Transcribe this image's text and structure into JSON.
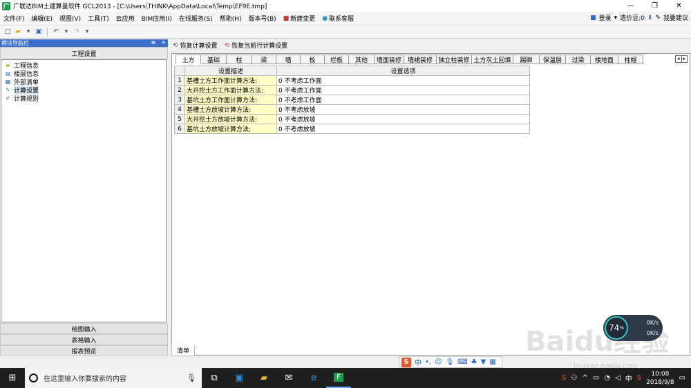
{
  "window": {
    "app_icon": "广",
    "title": "广联达BIM土建算量软件 GCL2013 - [C:\\Users\\THINK\\AppData\\Local\\Temp\\EF9E.tmp]",
    "minimize": "—",
    "restore": "❐",
    "close": "✕"
  },
  "menu": {
    "items": [
      "文件(F)",
      "编辑(E)",
      "视图(V)",
      "工具(T)",
      "云应用",
      "BIM应用(I)",
      "在线服务(S)",
      "帮助(H)",
      "版本号(B)",
      "新建变更",
      "联系客服"
    ],
    "login": "登录",
    "price_beans": "造价豆:0",
    "suggest": "我要建议"
  },
  "nav": {
    "header": "模块导航栏",
    "pin": "⊕",
    "close": "✕",
    "section_title": "工程设置",
    "tree": [
      {
        "label": "工程信息",
        "icon": "folder-icon"
      },
      {
        "label": "楼层信息",
        "icon": "floors-icon"
      },
      {
        "label": "外部清单",
        "icon": "list-icon"
      },
      {
        "label": "计算设置",
        "icon": "calc-icon"
      },
      {
        "label": "计算规则",
        "icon": "rules-icon"
      }
    ],
    "bottom": [
      "绘图输入",
      "表格输入",
      "报表预览"
    ]
  },
  "right_toolbar": {
    "restore_calc": "恢复计算设置",
    "restore_row": "恢复当前行计算设置"
  },
  "tabs": [
    "土方",
    "基础",
    "柱",
    "梁",
    "墙",
    "板",
    "栏板",
    "其他",
    "墙面装修",
    "墙裙装修",
    "独立柱装修",
    "土方灰土回填",
    "踢脚",
    "保温层",
    "过梁",
    "楼地面",
    "柱帽"
  ],
  "grid": {
    "col_desc": "设置描述",
    "col_opt": "设置选项",
    "rows": [
      {
        "num": "1",
        "desc": "基槽土方工作面计算方法:",
        "opt": "0 不考虑工作面"
      },
      {
        "num": "2",
        "desc": "大开挖土方工作面计算方法:",
        "opt": "0 不考虑工作面"
      },
      {
        "num": "3",
        "desc": "基坑土方工作面计算方法:",
        "opt": "0 不考虑工作面"
      },
      {
        "num": "4",
        "desc": "基槽土方放坡计算方法:",
        "opt": "0 不考虑放坡"
      },
      {
        "num": "5",
        "desc": "大开挖土方放坡计算方法:",
        "opt": "0 不考虑放坡"
      },
      {
        "num": "6",
        "desc": "基坑土方放坡计算方法:",
        "opt": "0 不考虑放坡"
      }
    ]
  },
  "bottom_tab": "清单",
  "ime": {
    "logo": "S",
    "mode": "中"
  },
  "speed": {
    "percent": "74",
    "unit": "%",
    "up": "0K/s",
    "down": "0K/s"
  },
  "watermark": {
    "main": "Baidu经验",
    "sub": "jingyan.baidu.com"
  },
  "taskbar": {
    "search_placeholder": "在这里输入你要搜索的内容",
    "ime": "中",
    "time": "10:08",
    "date": "2018/9/8"
  }
}
